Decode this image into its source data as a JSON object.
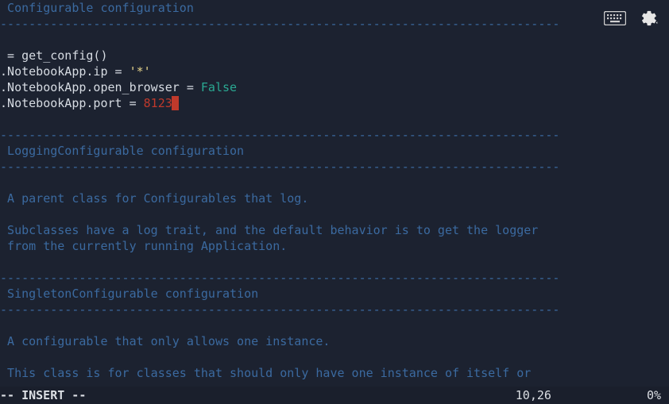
{
  "toolbar": {
    "keyboard_icon": "keyboard",
    "settings_icon": "settings"
  },
  "code": {
    "sec1_title": "# Configurable configuration",
    "dash_short": "#------------------------------------------------------------------------------",
    "dash_long": "#--------------------------------------------------------------------------------------",
    "blank": "",
    "l_getconfig": "c = get_config()",
    "l_ip_pre": "c.NotebookApp.ip = ",
    "l_ip_str": "'*'",
    "l_ob_pre": "c.NotebookApp.open_browser = ",
    "l_ob_val": "False",
    "l_port_pre": "c.NotebookApp.port = ",
    "l_port_val": "8123",
    "hash": "#",
    "sec2_title": "# LoggingConfigurable configuration",
    "c_parent": "# A parent class for Configurables that log.",
    "c_sub1": "# Subclasses have a log trait, and the default behavior is to get the logger",
    "c_sub2": "# from the currently running Application.",
    "sec3_title": "# SingletonConfigurable configuration",
    "c_cfg1": "# A configurable that only allows one instance.",
    "c_cfg2": "# This class is for classes that should only have one instance of itself or"
  },
  "status": {
    "mode": "-- INSERT --",
    "position": "10,26",
    "percent": "0%"
  }
}
